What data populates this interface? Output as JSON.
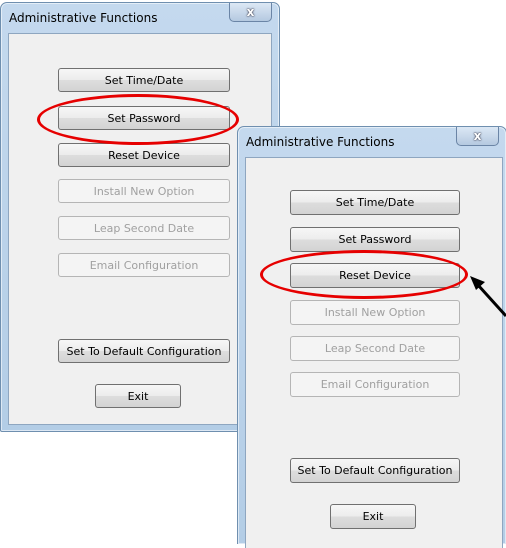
{
  "window1": {
    "title": "Administrative Functions",
    "close_glyph": "x",
    "buttons": [
      {
        "label": "Set Time/Date",
        "enabled": true
      },
      {
        "label": "Set Password",
        "enabled": true
      },
      {
        "label": "Reset Device",
        "enabled": true
      },
      {
        "label": "Install New Option",
        "enabled": false
      },
      {
        "label": "Leap Second Date",
        "enabled": false
      },
      {
        "label": "Email Configuration",
        "enabled": false
      },
      {
        "label": "Set To Default Configuration",
        "enabled": true
      },
      {
        "label": "Exit",
        "enabled": true
      }
    ]
  },
  "window2": {
    "title": "Administrative Functions",
    "close_glyph": "x",
    "buttons": [
      {
        "label": "Set Time/Date",
        "enabled": true
      },
      {
        "label": "Set Password",
        "enabled": true
      },
      {
        "label": "Reset Device",
        "enabled": true
      },
      {
        "label": "Install New Option",
        "enabled": false
      },
      {
        "label": "Leap Second Date",
        "enabled": false
      },
      {
        "label": "Email Configuration",
        "enabled": false
      },
      {
        "label": "Set To Default Configuration",
        "enabled": true
      },
      {
        "label": "Exit",
        "enabled": true
      }
    ]
  },
  "colors": {
    "highlight": "#e60000",
    "arrow": "#000000"
  }
}
